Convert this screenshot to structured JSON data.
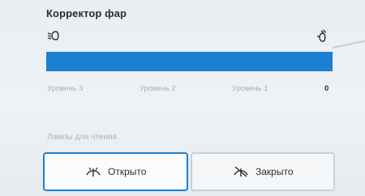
{
  "headlight": {
    "title": "Корректор фар",
    "level": {
      "current": 0,
      "fill_fraction": 1.0
    },
    "labels": [
      "Уровень 3",
      "Уровень 2",
      "Уровень 1",
      "0"
    ],
    "icons": {
      "low": "headlight-low-icon",
      "high": "headlight-high-icon"
    },
    "accent_color": "#1b7fd1"
  },
  "reading_lamps": {
    "title": "Лампы для чтения",
    "buttons": [
      {
        "label": "Открыто",
        "icon": "lamp-open-icon",
        "selected": true
      },
      {
        "label": "Закрыто",
        "icon": "lamp-closed-icon",
        "selected": false
      }
    ]
  }
}
